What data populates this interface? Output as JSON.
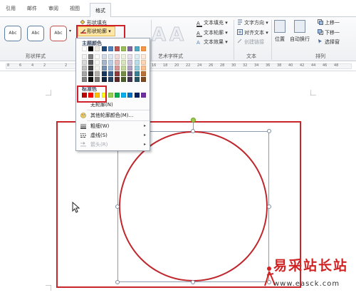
{
  "tabs": [
    {
      "label": "引用"
    },
    {
      "label": "邮件"
    },
    {
      "label": "审阅"
    },
    {
      "label": "视图"
    },
    {
      "label": "格式"
    }
  ],
  "ribbon": {
    "shape_styles": [
      "Abc",
      "Abc",
      "Abc"
    ],
    "shape_fill": "形状填充",
    "shape_outline": "形状轮廓",
    "text_fill": "文本填充",
    "text_outline": "文本轮廓",
    "text_effect": "文本效果",
    "text_direction": "文字方向",
    "align_text": "对齐文本",
    "create_link": "创建链接",
    "position": "位置",
    "wrap_text": "自动换行",
    "bring_forward": "上移一",
    "send_backward": "下移一",
    "selection_pane": "选择窗",
    "groups": {
      "shape_styles": "形状样式",
      "wordart": "艺术字样式",
      "text": "文本",
      "arrange": "排列"
    }
  },
  "dropdown": {
    "theme_colors_label": "主题颜色",
    "standard_colors_label": "标准色",
    "no_outline": "无轮廓(N)",
    "more_colors": "其他轮廓颜色(M)...",
    "weight": "粗细(W)",
    "dashes": "虚线(S)",
    "arrows": "箭头(R)",
    "theme_top_row": [
      "#ffffff",
      "#000000",
      "#eeece1",
      "#1f497d",
      "#4f81bd",
      "#c0504d",
      "#9bbb59",
      "#8064a2",
      "#4bacc6",
      "#f79646"
    ],
    "standard_colors": [
      "#c00000",
      "#ff0000",
      "#ffc000",
      "#ffff00",
      "#92d050",
      "#00b050",
      "#00b0f0",
      "#0070c0",
      "#002060",
      "#7030a0"
    ]
  },
  "ruler_numbers": [
    "8",
    "6",
    "4",
    "2",
    "2",
    "4",
    "6",
    "8",
    "10",
    "12",
    "14",
    "16",
    "18",
    "20",
    "22",
    "24",
    "26",
    "28",
    "30",
    "32",
    "34",
    "36",
    "38",
    "40",
    "42",
    "44",
    "46",
    "48"
  ],
  "watermark": {
    "title": "易采站长站",
    "url": "www.easck.com"
  },
  "colors": {
    "highlight_red": "#d0212a",
    "circle_outline": "#c0272d",
    "active_button": "#fde6a6"
  }
}
